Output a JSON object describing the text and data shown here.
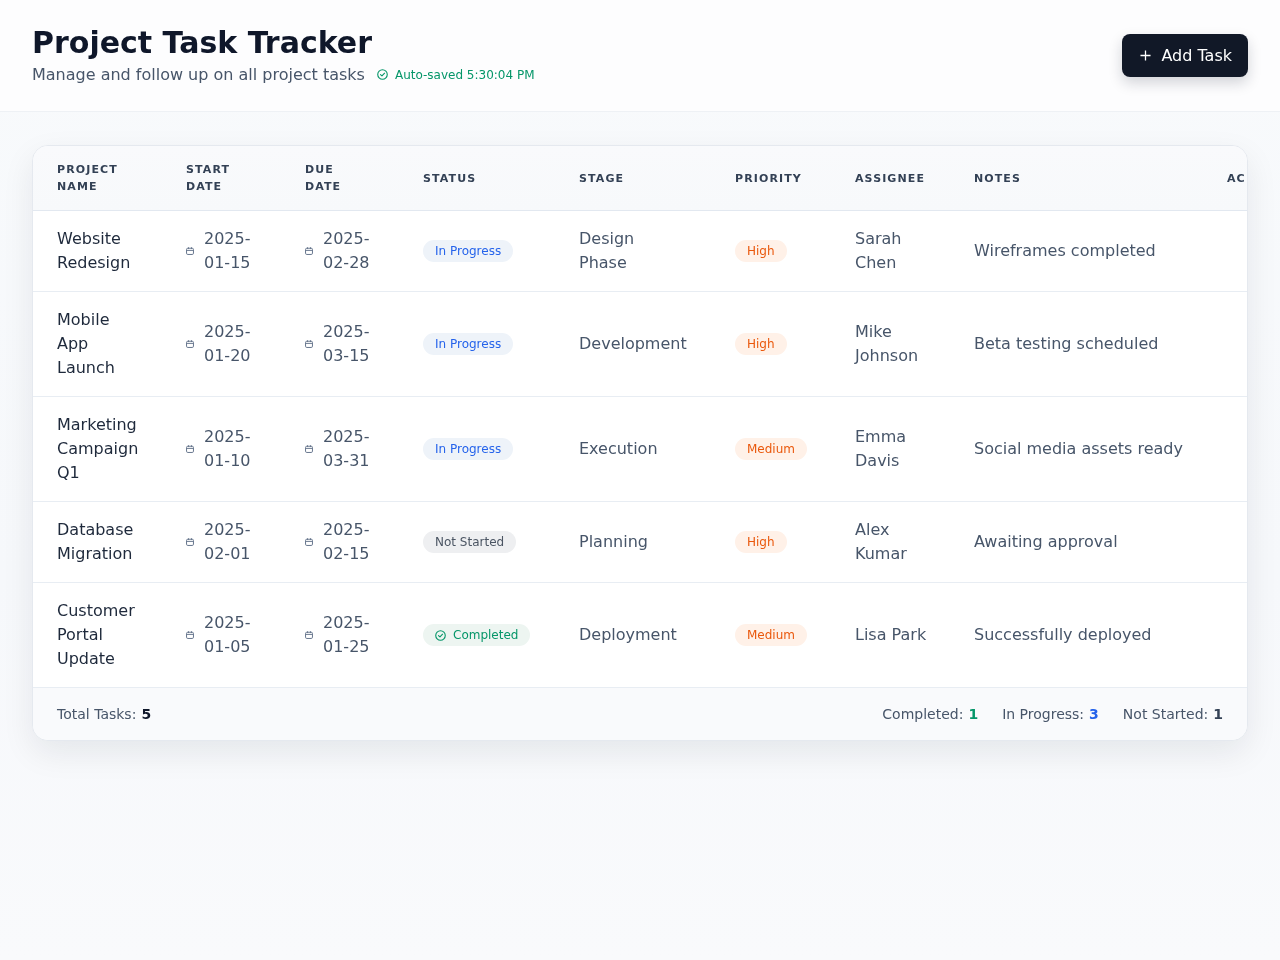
{
  "header": {
    "title": "Project Task Tracker",
    "subtitle": "Manage and follow up on all project tasks",
    "autosave": "Auto-saved 5:30:04 PM",
    "add_button": "Add Task"
  },
  "table": {
    "columns": [
      "PROJECT NAME",
      "START DATE",
      "DUE DATE",
      "STATUS",
      "STAGE",
      "PRIORITY",
      "ASSIGNEE",
      "NOTES",
      "AC"
    ],
    "rows": [
      {
        "project_name": "Website Redesign",
        "start_date": "2025-01-15",
        "due_date": "2025-02-28",
        "status": {
          "label": "In Progress",
          "kind": "in_progress"
        },
        "stage": "Design Phase",
        "priority": "High",
        "assignee": "Sarah Chen",
        "notes": "Wireframes completed"
      },
      {
        "project_name": "Mobile App Launch",
        "start_date": "2025-01-20",
        "due_date": "2025-03-15",
        "status": {
          "label": "In Progress",
          "kind": "in_progress"
        },
        "stage": "Development",
        "priority": "High",
        "assignee": "Mike Johnson",
        "notes": "Beta testing scheduled"
      },
      {
        "project_name": "Marketing Campaign Q1",
        "start_date": "2025-01-10",
        "due_date": "2025-03-31",
        "status": {
          "label": "In Progress",
          "kind": "in_progress"
        },
        "stage": "Execution",
        "priority": "Medium",
        "assignee": "Emma Davis",
        "notes": "Social media assets ready"
      },
      {
        "project_name": "Database Migration",
        "start_date": "2025-02-01",
        "due_date": "2025-02-15",
        "status": {
          "label": "Not Started",
          "kind": "not_started"
        },
        "stage": "Planning",
        "priority": "High",
        "assignee": "Alex Kumar",
        "notes": "Awaiting approval"
      },
      {
        "project_name": "Customer Portal Update",
        "start_date": "2025-01-05",
        "due_date": "2025-01-25",
        "status": {
          "label": "Completed",
          "kind": "completed"
        },
        "stage": "Deployment",
        "priority": "Medium",
        "assignee": "Lisa Park",
        "notes": "Successfully deployed"
      }
    ]
  },
  "footer": {
    "total": {
      "label": "Total Tasks:",
      "value": "5"
    },
    "stats": [
      {
        "label": "Completed:",
        "value": "1",
        "color": "#059669"
      },
      {
        "label": "In Progress:",
        "value": "3",
        "color": "#2563eb"
      },
      {
        "label": "Not Started:",
        "value": "1",
        "color": "#334155"
      }
    ]
  }
}
